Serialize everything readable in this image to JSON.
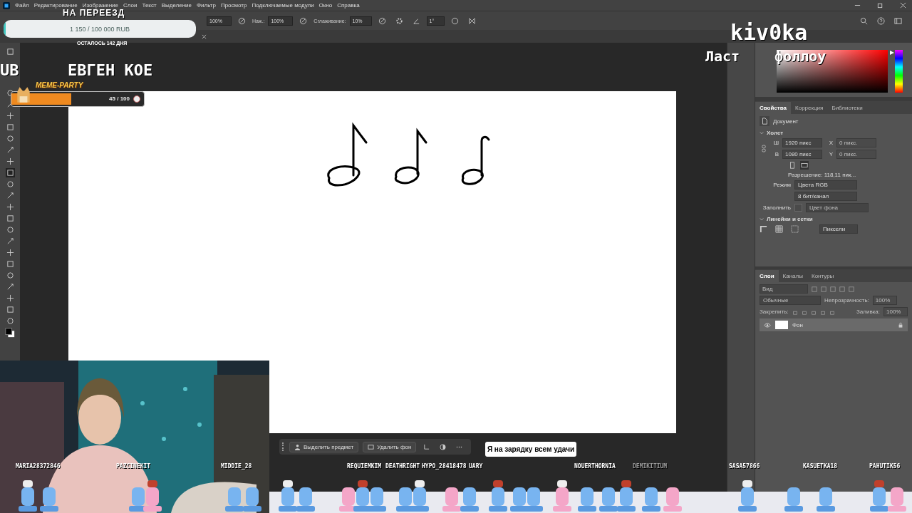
{
  "menu": [
    "Файл",
    "Редактирование",
    "Изображение",
    "Слои",
    "Текст",
    "Выделение",
    "Фильтр",
    "Просмотр",
    "Подключаемые модули",
    "Окно",
    "Справка"
  ],
  "options": [
    {
      "value": "100%"
    },
    {
      "label": "Наж.:",
      "value": "100%"
    },
    {
      "label": "Сглаживание:",
      "value": "10%"
    }
  ],
  "angle": "1°",
  "donation_goal": {
    "title": "НА ПЕРЕЕЗД",
    "amount": "1 150 / 100 000 RUB",
    "level": 0.0115,
    "remaining": "ОСТАЛОСЬ 142 ДНЯ"
  },
  "ticker": [
    "UB",
    "ЕВГЕН КОЕ"
  ],
  "meme_party": {
    "title": "MEME-PARTY",
    "count": "45 / 100",
    "level": 0.45
  },
  "color_picker": {
    "level": 0.98
  },
  "streamer_name": "kiv0ka",
  "last_follow_label": "Ласт",
  "last_follow_tail": "фоллоу",
  "properties": {
    "tabs": [
      {
        "label": "Свойства",
        "selected": true
      },
      {
        "label": "Коррекция",
        "selected": false
      },
      {
        "label": "Библиотеки",
        "selected": false
      }
    ],
    "document": "Документ",
    "canvas_section": {
      "title": "Холст",
      "expanded": true,
      "width_label": "Ш",
      "width": "1920 пикс",
      "height_label": "В",
      "height": "1080 пикс",
      "x_label": "X",
      "x": "0 пикс.",
      "y_label": "Y",
      "y": "0 пикс.",
      "resolution": "Разрешение: 118,11 пик...",
      "mode_label": "Режим",
      "mode": "Цвета RGB",
      "depth": "8 бит/канал",
      "fill_label": "Заполнить",
      "fill": "Цвет фона"
    },
    "rulers_section": {
      "title": "Линейки и сетки",
      "expanded": true,
      "unit": "Пиксели"
    }
  },
  "layers": {
    "tabs": [
      {
        "label": "Слои",
        "selected": true
      },
      {
        "label": "Каналы",
        "selected": false
      },
      {
        "label": "Контуры",
        "selected": false
      }
    ],
    "search_placeholder": "Вид",
    "blend": "Обычные",
    "opacity_label": "Непрозрачность:",
    "opacity": "100%",
    "lock_label": "Закрепить:",
    "fill_label": "Заливка:",
    "fill": "100%",
    "items": [
      {
        "name": "Фон",
        "visible": true,
        "locked": true
      }
    ]
  },
  "context_bar": [
    "Выделить предмет",
    "Удалить фон"
  ],
  "chat_bubble": "Я на зарядку всем удачи",
  "chatters": [
    {
      "name": "MARIA28372846",
      "faint": false
    },
    {
      "name": "PAZCINEKIT",
      "faint": false
    },
    {
      "name": "MIDDIE_28",
      "faint": false
    },
    {
      "name": "REQUIEMKIM",
      "faint": false
    },
    {
      "name": "DEATHRIGHT",
      "faint": false
    },
    {
      "name": "HYPO_28418478",
      "faint": false
    },
    {
      "name": "UARY",
      "faint": false
    },
    {
      "name": "NOUERTHORNIA",
      "faint": false
    },
    {
      "name": "DEMIKITIUM",
      "faint": true
    },
    {
      "name": "SASA57866",
      "faint": false
    },
    {
      "name": "KASUETKA18",
      "faint": false
    },
    {
      "name": "PAHUTIK56",
      "faint": false
    }
  ]
}
